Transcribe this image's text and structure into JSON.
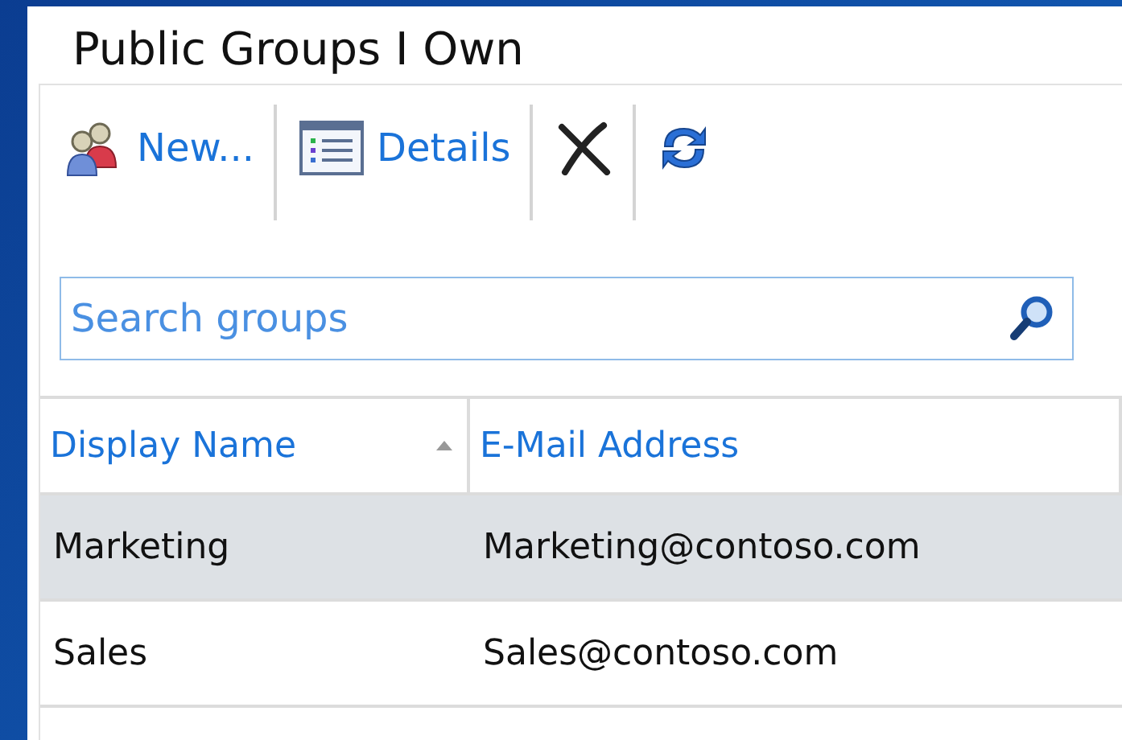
{
  "title": "Public Groups I Own",
  "toolbar": [
    {
      "kind": "new",
      "label": "New..."
    },
    {
      "kind": "details",
      "label": "Details"
    },
    {
      "kind": "delete"
    },
    {
      "kind": "refresh"
    }
  ],
  "search": {
    "placeholder": "Search groups"
  },
  "table": {
    "columns": [
      {
        "label": "Display Name",
        "sorted": true
      },
      {
        "label": "E-Mail Address",
        "sorted": false
      }
    ],
    "rows": [
      {
        "cells": [
          "Marketing",
          "Marketing@contoso.com"
        ],
        "selected": true
      },
      {
        "cells": [
          "Sales",
          "Sales@contoso.com"
        ],
        "selected": false
      }
    ]
  }
}
